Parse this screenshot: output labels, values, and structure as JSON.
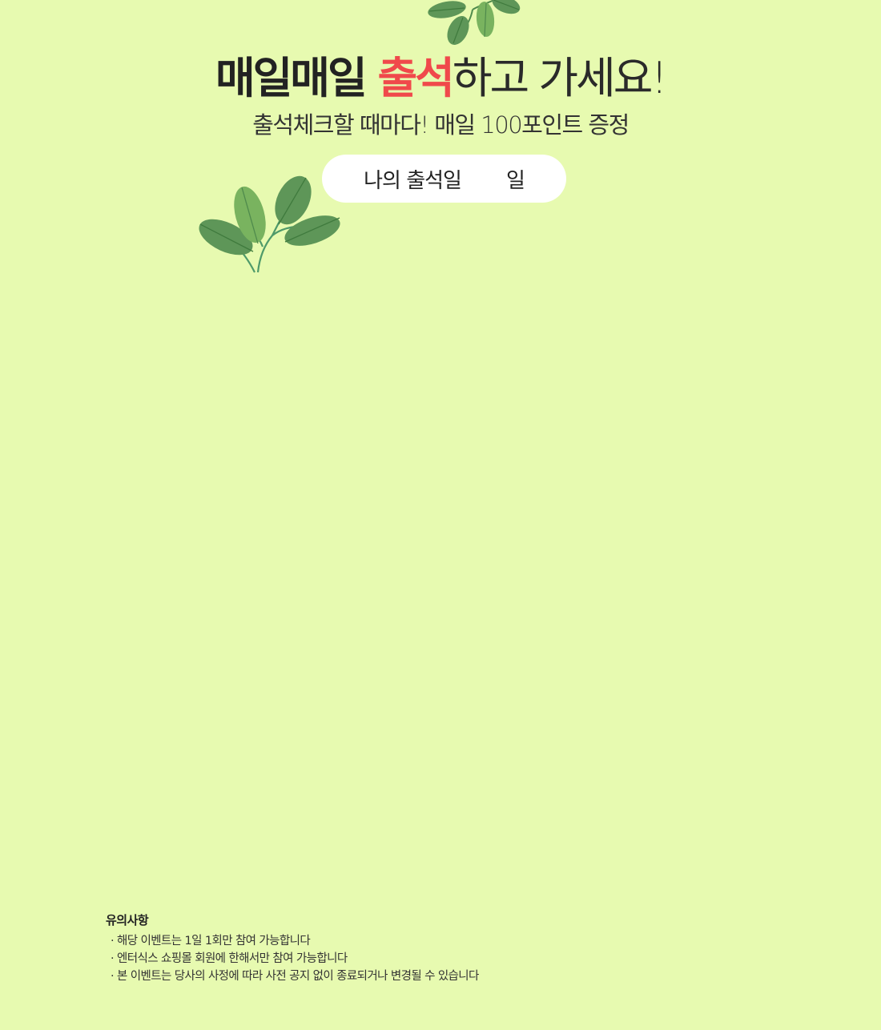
{
  "headline": {
    "part1": "매일매일 ",
    "part2": "출석",
    "part3": "하고 가세요!"
  },
  "subtitle": "출석체크할 때마다! 매일 100포인트 증정",
  "attendance": {
    "label": "나의 출석일",
    "count": "",
    "unit": "일"
  },
  "notice": {
    "title": "유의사항",
    "items": [
      "해당 이벤트는 1일 1회만 참여 가능합니다",
      "엔터식스 쇼핑몰 회원에 한해서만 참여 가능합니다",
      "본 이벤트는 당사의 사정에 따라 사전 공지 없이 종료되거나 변경될 수 있습니다"
    ]
  },
  "colors": {
    "background": "#e7fab0",
    "accent": "#f0494b",
    "leaf_dark": "#5e9658",
    "leaf_light": "#79b35f"
  },
  "icons": {
    "top_decoration": "leaf-branch-icon",
    "left_decoration": "leaf-branch-icon"
  }
}
